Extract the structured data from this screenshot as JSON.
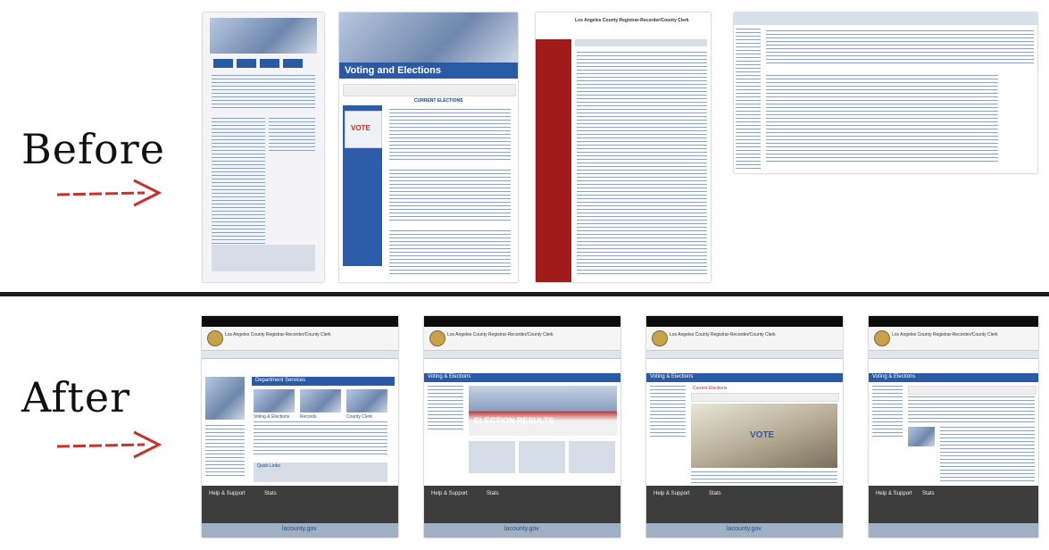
{
  "labels": {
    "before": "Before",
    "after": "After"
  },
  "before_thumbs": [
    {
      "id": "before-home"
    },
    {
      "id": "before-voting",
      "title": "Voting and Elections",
      "badge": "VOTE",
      "section": "CURRENT ELECTIONS"
    },
    {
      "id": "before-elections-list",
      "header": "Los Angeles County Registrar-Recorder/County Clerk"
    },
    {
      "id": "before-text-page"
    }
  ],
  "after_thumbs": [
    {
      "id": "after-home",
      "header": "Los Angeles County Registrar-Recorder/County Clerk",
      "banner": "Department Services",
      "columns": [
        "Voting & Elections",
        "Records",
        "County Clerk"
      ],
      "quick": "Quick Links",
      "footer_left": "Help & Support",
      "footer_right": "Stats",
      "brand": "lacounty.gov"
    },
    {
      "id": "after-voting",
      "header": "Los Angeles County Registrar-Recorder/County Clerk",
      "banner": "Voting & Elections",
      "hero": "ELECTION RESULTS",
      "footer_left": "Help & Support",
      "footer_right": "Stats",
      "brand": "lacounty.gov"
    },
    {
      "id": "after-current",
      "header": "Los Angeles County Registrar-Recorder/County Clerk",
      "banner": "Voting & Elections",
      "section": "Current Elections",
      "badge": "VOTE",
      "footer_left": "Help & Support",
      "footer_right": "Stats",
      "brand": "lacounty.gov"
    },
    {
      "id": "after-detail",
      "header": "Los Angeles County Registrar-Recorder/County Clerk",
      "banner": "Voting & Elections",
      "footer_left": "Help & Support",
      "footer_right": "Stats"
    }
  ],
  "colors": {
    "accent": "#2a5aa6",
    "arrow": "#c8322b",
    "dark": "#1d1d1d"
  }
}
